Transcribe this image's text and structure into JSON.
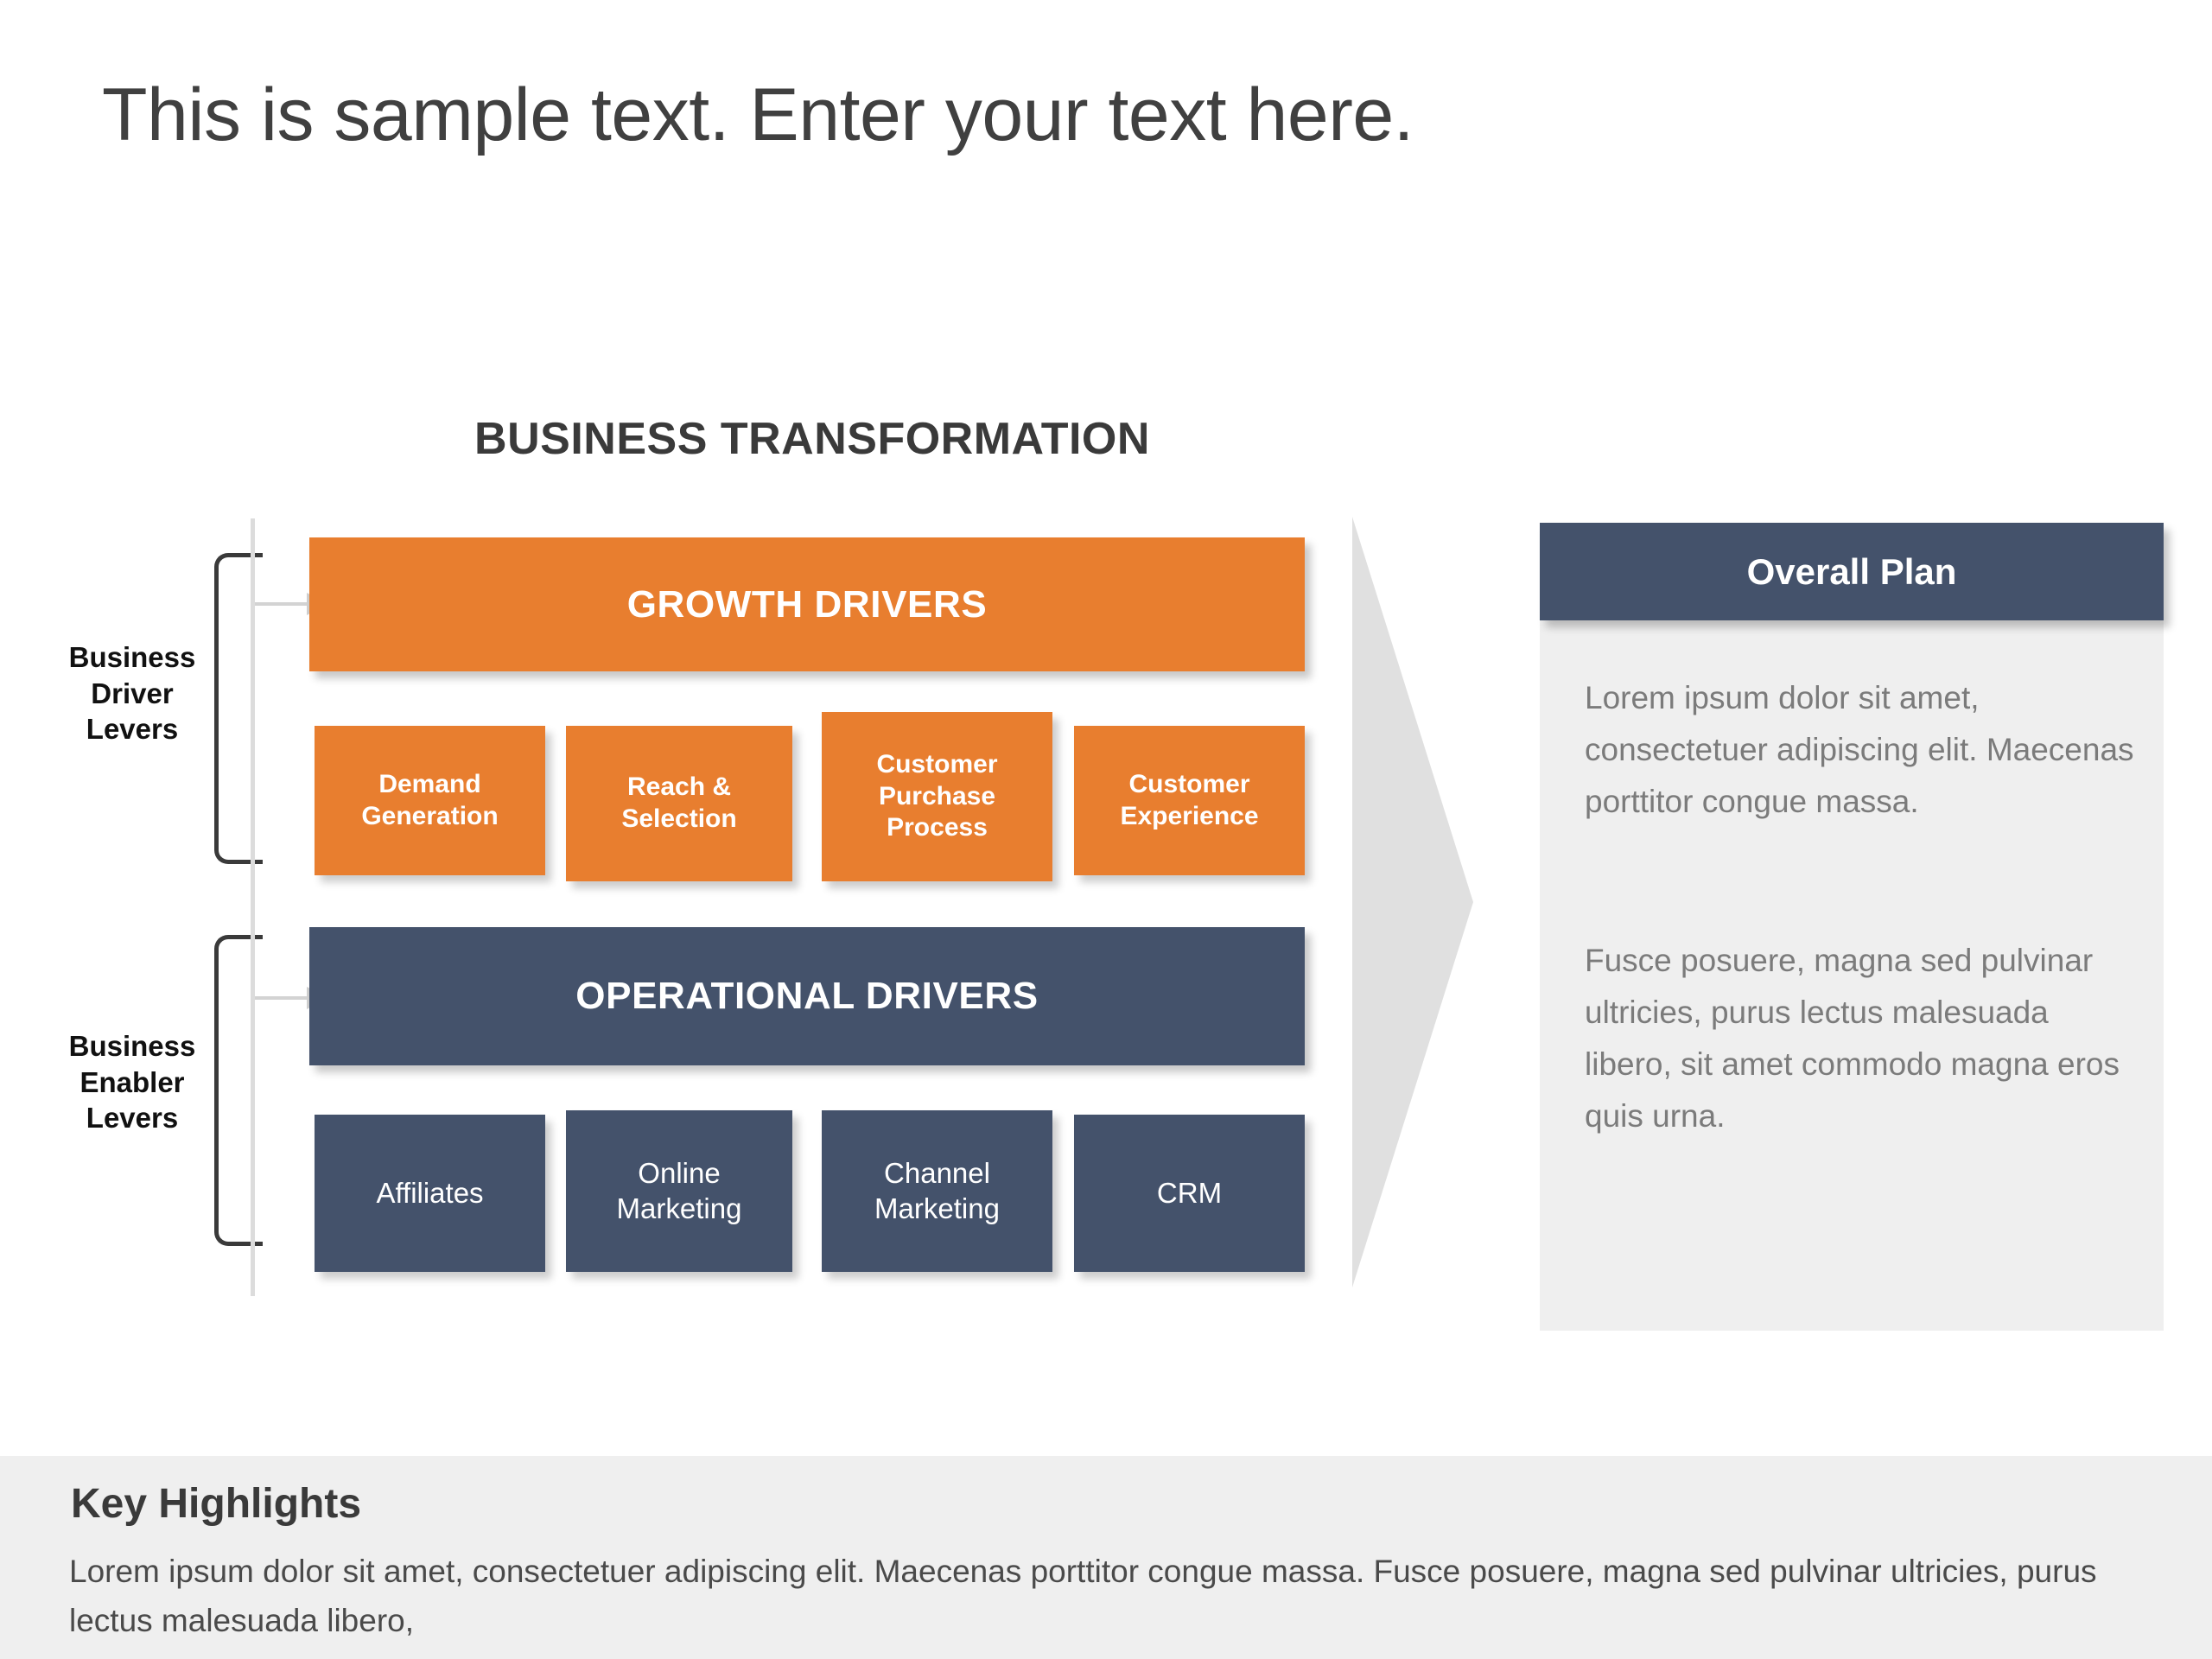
{
  "slide": {
    "title": "This is sample text. Enter your text here."
  },
  "diagram": {
    "title": "BUSINESS TRANSFORMATION",
    "levers": [
      {
        "label": "Business\nDriver\nLevers",
        "line1": "Business",
        "line2": "Driver",
        "line3": "Levers"
      },
      {
        "label": "Business\nEnabler\nLevers",
        "line1": "Business",
        "line2": "Enabler",
        "line3": "Levers"
      }
    ],
    "growth": {
      "banner": "GROWTH DRIVERS",
      "color": "#E87E2F",
      "items": [
        "Demand Generation",
        "Reach & Selection",
        "Customer Purchase Process",
        "Customer Experience"
      ]
    },
    "operational": {
      "banner": "OPERATIONAL DRIVERS",
      "color": "#44526B",
      "items": [
        "Affiliates",
        "Online Marketing",
        "Channel Marketing",
        "CRM"
      ]
    },
    "arrow_icon": "right-chevron-arrow",
    "arrow_color": "#e0e0e0"
  },
  "panel": {
    "header": "Overall Plan",
    "header_color": "#44526B",
    "background_color": "#efefef",
    "paragraphs": [
      "Lorem ipsum dolor sit amet, consectetuer adipiscing elit. Maecenas porttitor congue massa.",
      "Fusce posuere, magna sed pulvinar ultricies, purus lectus malesuada libero, sit amet commodo magna eros quis urna."
    ]
  },
  "footer": {
    "title": "Key Highlights",
    "text": "Lorem ipsum dolor sit amet, consectetuer adipiscing elit. Maecenas porttitor congue massa. Fusce posuere, magna sed pulvinar ultricies, purus lectus malesuada libero,",
    "background_color": "#efefef"
  }
}
